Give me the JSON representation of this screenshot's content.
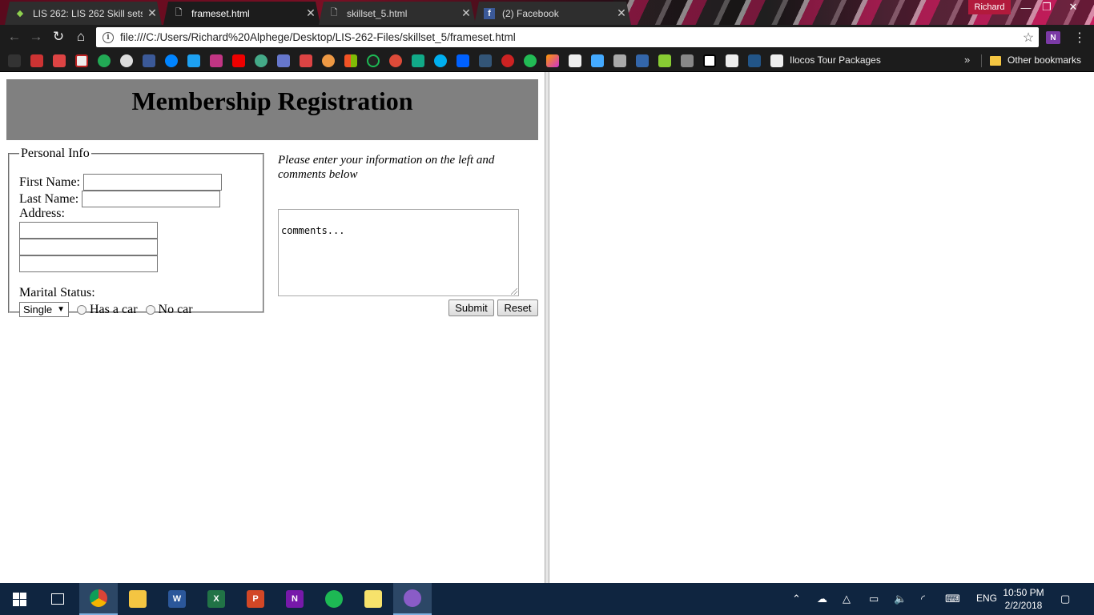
{
  "browser": {
    "tabs": [
      {
        "label": "LIS 262: LIS 262 Skill sets",
        "icon": "course-site-icon",
        "active": false
      },
      {
        "label": "frameset.html",
        "icon": "document-icon",
        "active": true
      },
      {
        "label": "skillset_5.html",
        "icon": "document-icon",
        "active": false
      },
      {
        "label": "(2) Facebook",
        "icon": "facebook-icon",
        "active": false
      }
    ],
    "profile_name": "Richard",
    "window_controls": {
      "minimize": "—",
      "restore": "❐",
      "close": "✕"
    },
    "address_url": "file:///C:/Users/Richard%20Alphege/Desktop/LIS-262-Files/skillset_5/frameset.html",
    "extension_label": "N",
    "bookmarks": {
      "named_bookmark": "Ilocos Tour Packages",
      "overflow": "»",
      "other_bookmarks": "Other bookmarks"
    }
  },
  "page": {
    "title": "Membership Registration",
    "personal_info": {
      "legend": "Personal Info",
      "first_name_label": "First Name:",
      "last_name_label": "Last Name:",
      "address_label": "Address:",
      "marital_label": "Marital Status:",
      "marital_selected": "Single",
      "radio_car": "Has a car",
      "radio_no_car": "No car"
    },
    "instructions": "Please enter your information on the left and comments below",
    "comments_value": "comments...",
    "submit_label": "Submit",
    "reset_label": "Reset"
  },
  "taskbar": {
    "language": "ENG",
    "time": "10:50 PM",
    "date": "2/2/2018"
  },
  "colors": {
    "banner": "#808080",
    "taskbar": "#0f2540",
    "browser_chrome": "#1c1c1c"
  }
}
